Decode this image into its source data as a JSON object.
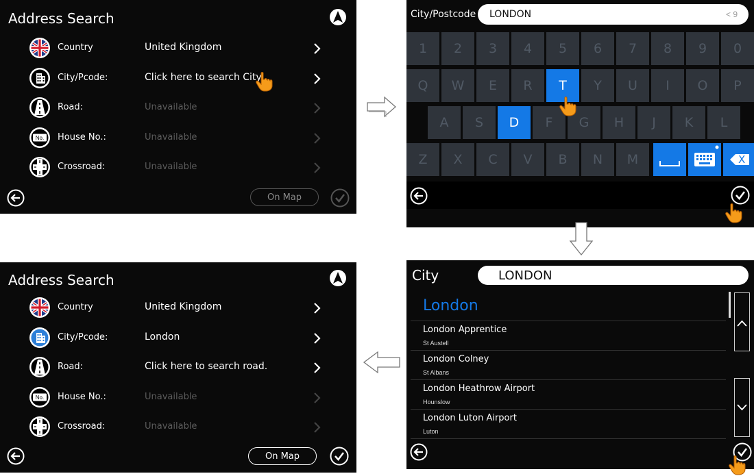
{
  "panel1": {
    "title": "Address Search",
    "rows": [
      {
        "icon": "uk-flag-icon",
        "label": "Country",
        "value": "United Kingdom",
        "enabled": true
      },
      {
        "icon": "city-icon",
        "label": "City/Pcode:",
        "value": "Click here to search City",
        "enabled": true
      },
      {
        "icon": "road-icon",
        "label": "Road:",
        "value": "Unavailable",
        "enabled": false
      },
      {
        "icon": "house-number-icon",
        "label": "House No.:",
        "value": "Unavailable",
        "enabled": false
      },
      {
        "icon": "crossroad-icon",
        "label": "Crossroad:",
        "value": "Unavailable",
        "enabled": false
      }
    ],
    "on_map": "On Map"
  },
  "panel2": {
    "label": "City/Postcode",
    "input_value": "LONDON",
    "count": "< 9",
    "keys_row1": [
      "1",
      "2",
      "3",
      "4",
      "5",
      "6",
      "7",
      "8",
      "9",
      "0"
    ],
    "keys_row2": [
      "Q",
      "W",
      "E",
      "R",
      "T",
      "Y",
      "U",
      "I",
      "O",
      "P"
    ],
    "keys_row3": [
      "A",
      "S",
      "D",
      "F",
      "G",
      "H",
      "J",
      "K",
      "L"
    ],
    "keys_row4": [
      "Z",
      "X",
      "C",
      "V",
      "B",
      "N",
      "M"
    ],
    "highlighted_keys": [
      "T",
      "D"
    ],
    "delete_key": "X"
  },
  "panel3": {
    "title": "City",
    "input_value": "LONDON",
    "top_result": "London",
    "results": [
      {
        "name": "London Apprentice",
        "sub": "St Austell"
      },
      {
        "name": "London Colney",
        "sub": "St Albans"
      },
      {
        "name": "London Heathrow Airport",
        "sub": "Hounslow"
      },
      {
        "name": "London Luton Airport",
        "sub": "Luton"
      }
    ]
  },
  "panel4": {
    "title": "Address Search",
    "rows": [
      {
        "icon": "uk-flag-icon",
        "label": "Country",
        "value": "United Kingdom",
        "enabled": true
      },
      {
        "icon": "city-icon",
        "label": "City/Pcode:",
        "value": "London",
        "enabled": true
      },
      {
        "icon": "road-icon",
        "label": "Road:",
        "value": "Click here to search road.",
        "enabled": true
      },
      {
        "icon": "house-number-icon",
        "label": "House No.:",
        "value": "Unavailable",
        "enabled": false
      },
      {
        "icon": "crossroad-icon",
        "label": "Crossroad:",
        "value": "Unavailable",
        "enabled": false
      }
    ],
    "on_map": "On Map"
  },
  "icons": {
    "house_no_text": "No."
  },
  "colors": {
    "accent": "#1479e6",
    "panel_bg": "#0a0a0a",
    "key_bg": "#2f343b",
    "disabled_text": "#5c5c5c"
  }
}
